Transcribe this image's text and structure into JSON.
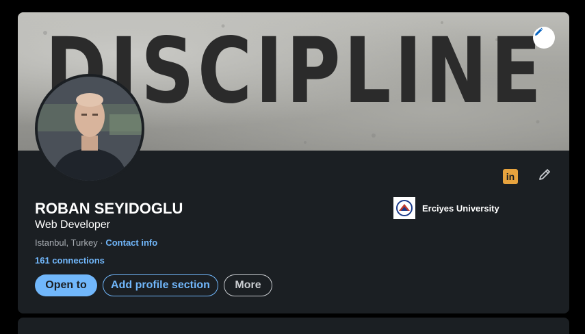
{
  "banner": {
    "text": "DISCIPLINE"
  },
  "profile": {
    "name": "ROBAN SEYIDOGLU",
    "headline": "Web Developer",
    "location": "Istanbul, Turkey",
    "separator": " · ",
    "contact_label": "Contact info",
    "connections": "161 connections"
  },
  "actions": {
    "open_to": "Open to",
    "add_section": "Add profile section",
    "more": "More"
  },
  "education": {
    "name": "Erciyes University"
  },
  "icons": {
    "banner_edit": "pencil-icon",
    "linkedin": "linkedin-icon",
    "profile_edit": "pencil-icon"
  },
  "colors": {
    "background": "#000000",
    "card": "#1b1f23",
    "accent": "#71b7fb",
    "linkedin_badge": "#e7a33e",
    "text_primary": "#ffffff",
    "text_secondary": "#a8adb3"
  }
}
